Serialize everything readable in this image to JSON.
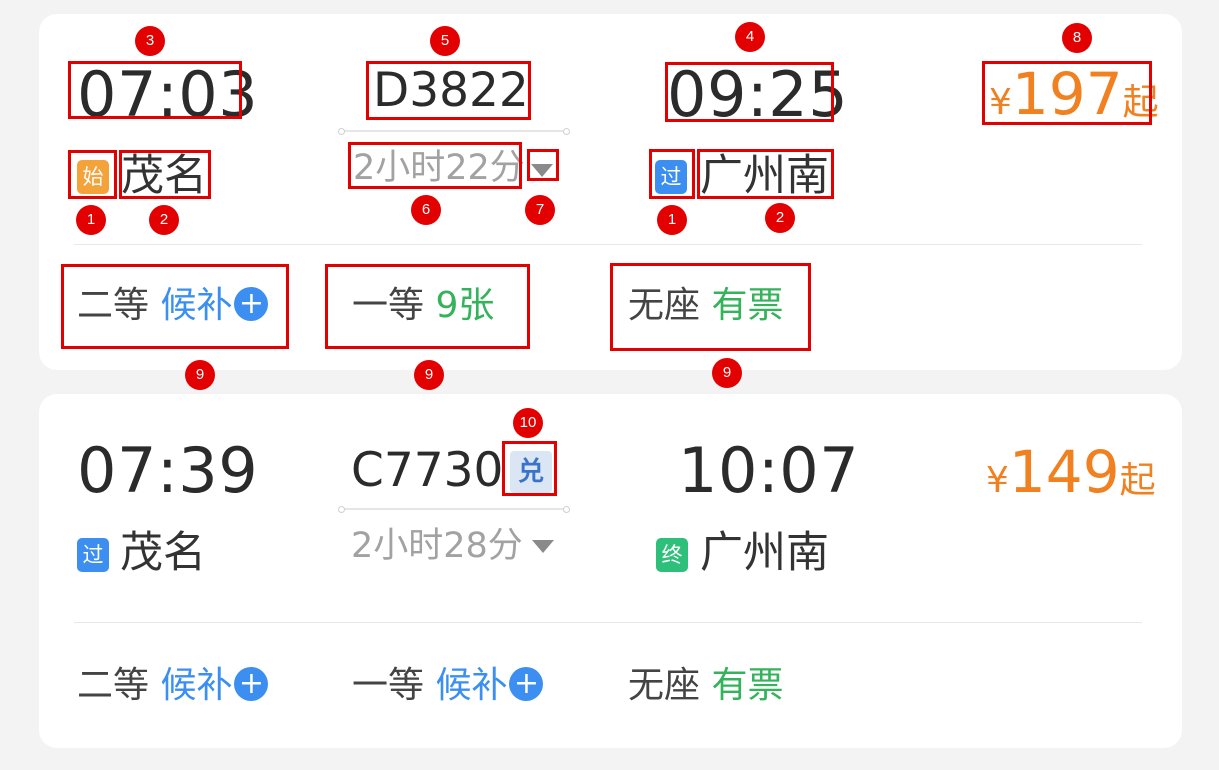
{
  "trains": [
    {
      "depart_time": "07:03",
      "train_no": "D3822",
      "arrive_time": "09:25",
      "duration": "2小时22分",
      "from_tag": "始",
      "from_station": "茂名",
      "to_tag": "过",
      "to_station": "广州南",
      "price_symbol": "¥",
      "price": "197",
      "price_suffix": "起",
      "seats": [
        {
          "cls": "二等",
          "status": "候补",
          "plus": "+"
        },
        {
          "cls": "一等",
          "status": "9张"
        },
        {
          "cls": "无座",
          "status": "有票"
        }
      ]
    },
    {
      "depart_time": "07:39",
      "train_no": "C7730",
      "badge": "兑",
      "arrive_time": "10:07",
      "duration": "2小时28分",
      "from_tag": "过",
      "from_station": "茂名",
      "to_tag": "终",
      "to_station": "广州南",
      "price_symbol": "¥",
      "price": "149",
      "price_suffix": "起",
      "seats": [
        {
          "cls": "二等",
          "status": "候补",
          "plus": "+"
        },
        {
          "cls": "一等",
          "status": "候补",
          "plus": "+"
        },
        {
          "cls": "无座",
          "status": "有票"
        }
      ]
    }
  ],
  "annotations": [
    "1",
    "2",
    "3",
    "4",
    "5",
    "6",
    "7",
    "8",
    "9",
    "10"
  ],
  "colors": {
    "price": "#f08020",
    "available": "#34b35a",
    "waitlist": "#3a8ff0",
    "tag_start": "#f3a33a",
    "tag_pass": "#3c8ff0",
    "tag_end": "#2ec07a",
    "annotation": "#e20000"
  }
}
